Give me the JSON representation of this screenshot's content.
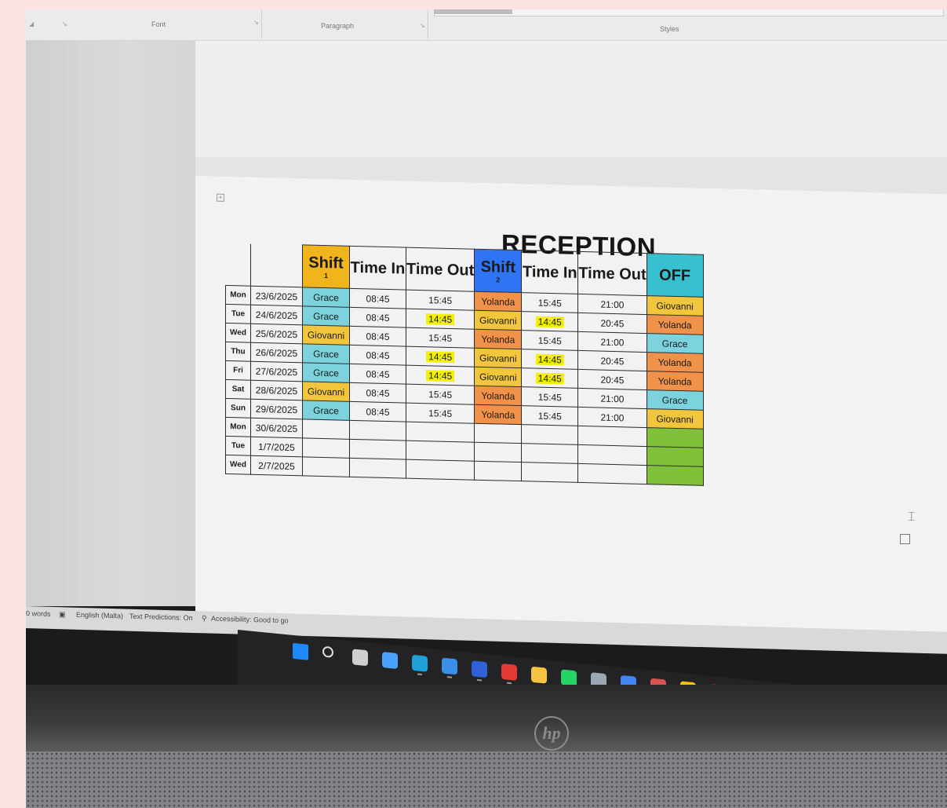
{
  "ribbon": {
    "font_label": "Font",
    "paragraph_label": "Paragraph",
    "styles_label": "Styles",
    "launcher": "↘"
  },
  "document": {
    "title": "RECEPTION",
    "headers": {
      "shift1": "Shift",
      "shift1_num": "1",
      "time_in": "Time In",
      "time_out": "Time Out",
      "shift2": "Shift",
      "shift2_num": "2",
      "time_in2": "Time In",
      "time_out2": "Time Out",
      "off": "OFF"
    },
    "rows": [
      {
        "day": "Mon",
        "date": "23/6/2025",
        "shift1": "Grace",
        "in1": "08:45",
        "out1": "15:45",
        "shift2": "Yolanda",
        "in2": "15:45",
        "out2": "21:00",
        "off": "Giovanni"
      },
      {
        "day": "Tue",
        "date": "24/6/2025",
        "shift1": "Grace",
        "in1": "08:45",
        "out1": "14:45",
        "shift2": "Giovanni",
        "in2": "14:45",
        "out2": "20:45",
        "off": "Yolanda"
      },
      {
        "day": "Wed",
        "date": "25/6/2025",
        "shift1": "Giovanni",
        "in1": "08:45",
        "out1": "15:45",
        "shift2": "Yolanda",
        "in2": "15:45",
        "out2": "21:00",
        "off": "Grace"
      },
      {
        "day": "Thu",
        "date": "26/6/2025",
        "shift1": "Grace",
        "in1": "08:45",
        "out1": "14:45",
        "shift2": "Giovanni",
        "in2": "14:45",
        "out2": "20:45",
        "off": "Yolanda"
      },
      {
        "day": "Fri",
        "date": "27/6/2025",
        "shift1": "Grace",
        "in1": "08:45",
        "out1": "14:45",
        "shift2": "Giovanni",
        "in2": "14:45",
        "out2": "20:45",
        "off": "Yolanda"
      },
      {
        "day": "Sat",
        "date": "28/6/2025",
        "shift1": "Giovanni",
        "in1": "08:45",
        "out1": "15:45",
        "shift2": "Yolanda",
        "in2": "15:45",
        "out2": "21:00",
        "off": "Grace"
      },
      {
        "day": "Sun",
        "date": "29/6/2025",
        "shift1": "Grace",
        "in1": "08:45",
        "out1": "15:45",
        "shift2": "Yolanda",
        "in2": "15:45",
        "out2": "21:00",
        "off": "Giovanni"
      },
      {
        "day": "Mon",
        "date": "30/6/2025",
        "shift1": "",
        "in1": "",
        "out1": "",
        "shift2": "",
        "in2": "",
        "out2": "",
        "off": ""
      },
      {
        "day": "Tue",
        "date": "1/7/2025",
        "shift1": "",
        "in1": "",
        "out1": "",
        "shift2": "",
        "in2": "",
        "out2": "",
        "off": ""
      },
      {
        "day": "Wed",
        "date": "2/7/2025",
        "shift1": "",
        "in1": "",
        "out1": "",
        "shift2": "",
        "in2": "",
        "out2": "",
        "off": ""
      }
    ],
    "highlight_times": [
      "14:45"
    ],
    "colors": {
      "shift1_header": "#f0b51c",
      "shift2_header": "#2f74f5",
      "off_header": "#38bfd0",
      "Grace": "#7dd3dd",
      "Yolanda": "#f0924a",
      "Giovanni": "#f2c63c",
      "empty_off": "#7fc23a",
      "highlight": "#f3f100"
    }
  },
  "statusbar": {
    "words": "0 words",
    "language": "English (Malta)",
    "text_predictions": "Text Predictions: On",
    "accessibility": "Accessibility: Good to go"
  },
  "taskbar": {
    "icons": [
      "windows-start-icon",
      "search-icon",
      "task-view-icon",
      "widgets-icon",
      "edge-icon",
      "outlook-icon",
      "store-icon",
      "app-red-icon",
      "file-explorer-icon",
      "whatsapp-icon",
      "calculator-icon",
      "chrome-icon",
      "mail-icon",
      "files-icon",
      "youtube-icon",
      "spotify-icon",
      "excel-icon",
      "word-icon",
      "globe-icon",
      "photos-icon",
      "acrobat-icon"
    ]
  },
  "laptop": {
    "logo": "hp"
  }
}
